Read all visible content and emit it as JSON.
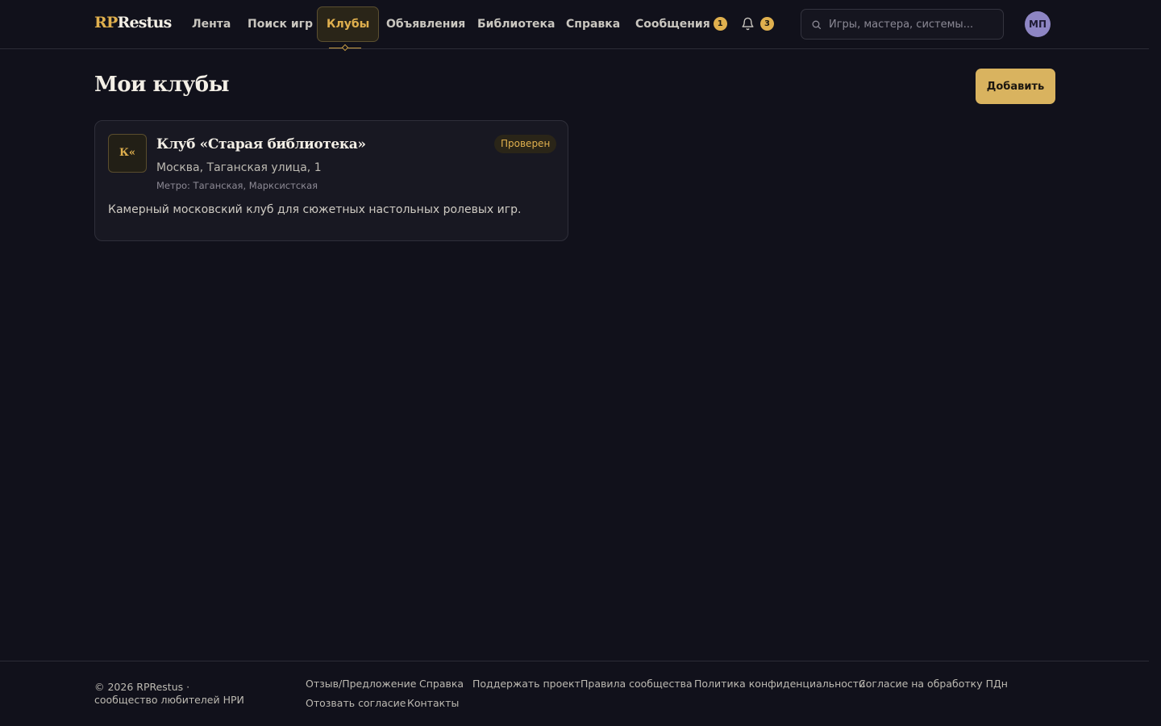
{
  "header": {
    "logo": {
      "accent": "RP",
      "rest": "Restus"
    },
    "nav": [
      {
        "label": "Лента"
      },
      {
        "label": "Поиск игр"
      },
      {
        "label": "Клубы"
      },
      {
        "label": "Объявления"
      },
      {
        "label": "Библиотека"
      },
      {
        "label": "Справка"
      },
      {
        "label": "Сообщения",
        "badge": "1"
      }
    ],
    "active_nav": "Клубы",
    "notifications": {
      "icon": "bell-icon",
      "count": "3"
    },
    "search": {
      "placeholder": "Игры, мастера, системы...",
      "value": "",
      "icon": "search-icon"
    },
    "avatar": {
      "initials": "МП"
    }
  },
  "main": {
    "title": "Мои клубы",
    "add_label": "Добавить",
    "clubs": [
      {
        "logo_text": "К«",
        "name": "Клуб «Старая библиотека»",
        "status": "Проверен",
        "address": "Москва, Таганская улица, 1",
        "metro": "Метро: Таганская, Марксистская",
        "description": "Камерный московский клуб для сюжетных настольных ролевых игр."
      }
    ]
  },
  "footer": {
    "copyright": "© 2026 RPRestus · сообщество любителей НРИ",
    "links": [
      "Отзыв/Предложение",
      "Справка",
      "Поддержать проект",
      "Правила сообщества",
      "Политика конфиденциальности",
      "Согласие на обработку ПДн",
      "Отозвать согласие",
      "Контакты"
    ]
  },
  "colors": {
    "background": "#11111b",
    "accent": "#e0b04e",
    "button": "#d9b35f",
    "avatar": "#8e86c4",
    "card": "#181822"
  }
}
